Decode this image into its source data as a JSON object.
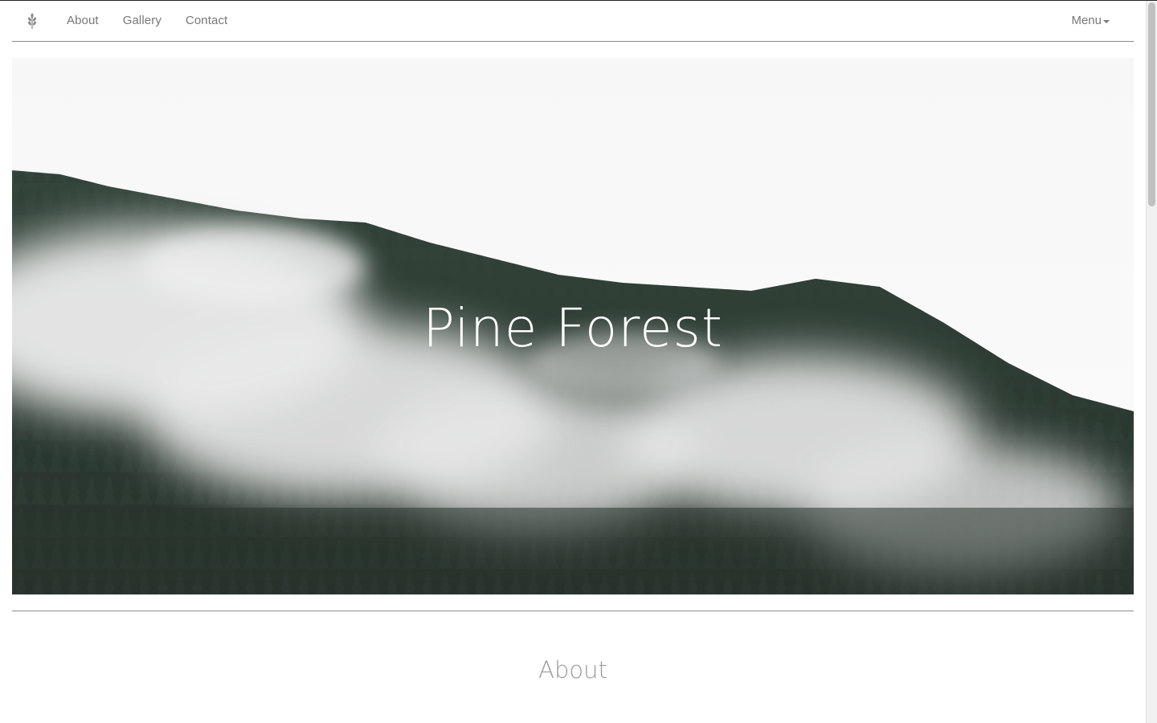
{
  "navbar": {
    "brand_icon": "wheat-icon",
    "links": [
      "About",
      "Gallery",
      "Contact"
    ],
    "menu_label": "Menu"
  },
  "hero": {
    "title": "Pine Forest"
  },
  "about": {
    "title": "About"
  },
  "colors": {
    "nav_text": "#777777",
    "rule": "#8a8a8a",
    "hero_title": "#ffffff",
    "section_title": "#9a9a9a",
    "forest_dark": "#2b3a33"
  }
}
